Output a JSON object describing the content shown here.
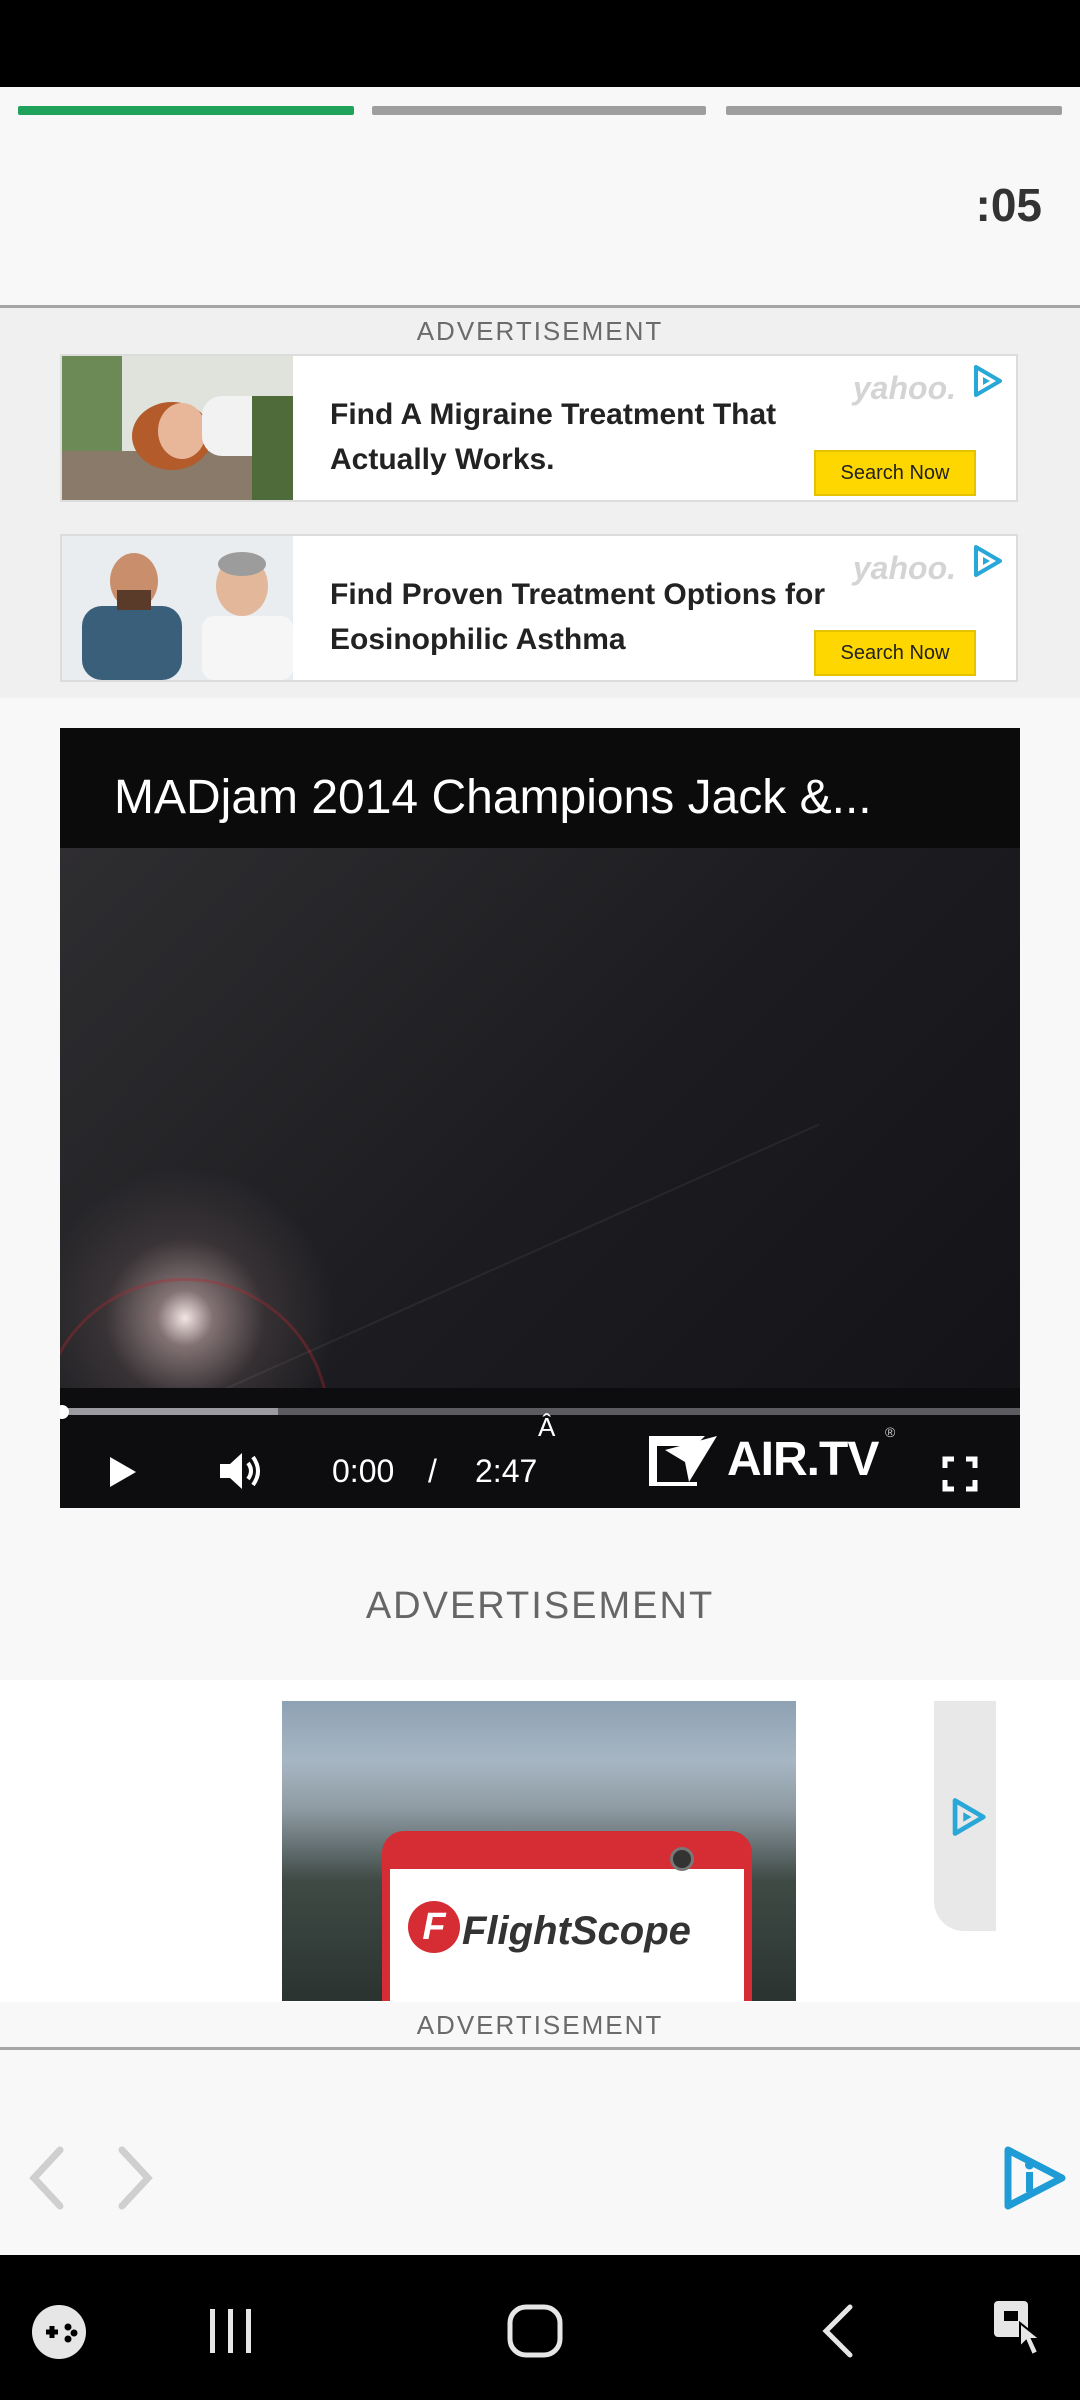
{
  "story": {
    "progress_segments": 3,
    "active_segment": 1,
    "countdown": ":05",
    "active_color": "#1fa35b"
  },
  "ads": {
    "label": "ADVERTISEMENT",
    "cards": [
      {
        "headline": "Find A Migraine Treatment That Actually Works.",
        "provider": "yahoo.",
        "cta": "Search Now"
      },
      {
        "headline": "Find Proven Treatment Options for Eosinophilic Asthma",
        "provider": "yahoo.",
        "cta": "Search Now"
      }
    ],
    "mid_label": "ADVERTISEMENT",
    "mid_brand": "FlightScope",
    "footer_label": "ADVERTISEMENT"
  },
  "video": {
    "title": "MADjam 2014 Champions Jack &...",
    "current_time": "0:00",
    "separator": "/",
    "duration": "2:47",
    "stray_char": "Â",
    "logo_text": "AIR.TV",
    "logo_reg": "®"
  },
  "icons": {
    "play": "play-icon",
    "volume": "volume-icon",
    "fullscreen": "fullscreen-icon",
    "ad_choices": "ad-choices-icon",
    "prev": "chevron-left-icon",
    "next": "chevron-right-icon",
    "brand": "brand-logo-icon"
  },
  "colors": {
    "accent_green": "#1fa35b",
    "ad_choices_blue": "#29a8d8",
    "cta_yellow": "#ffd700"
  }
}
